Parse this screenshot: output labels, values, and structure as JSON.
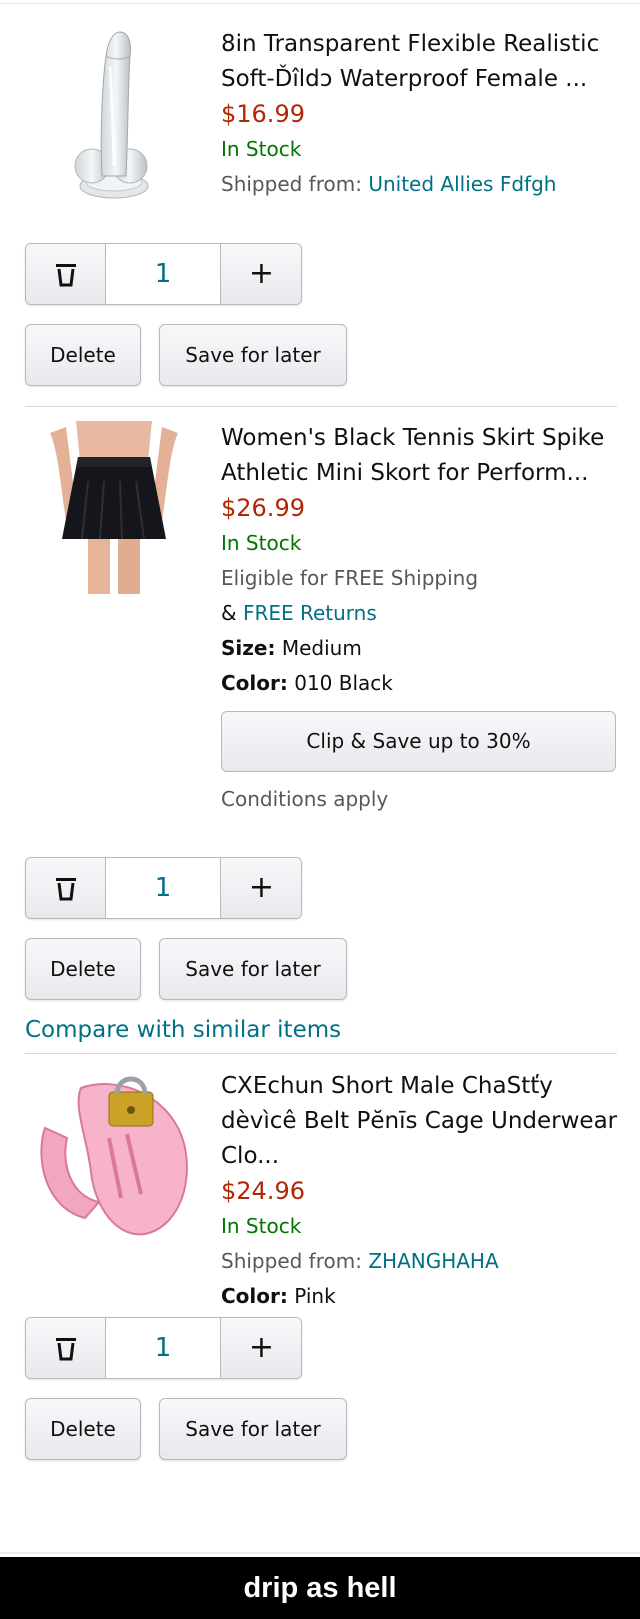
{
  "items": [
    {
      "title": "8in Transparent Flexible Realistic Soft-Ďîldɔ Waterproof Female ...",
      "price": "$16.99",
      "stock": "In Stock",
      "shipped_label": "Shipped from: ",
      "seller": "United Allies Fdfgh",
      "quantity": "1"
    },
    {
      "title": "Women's Black Tennis Skirt Spike Athletic Mini Skort for Perform...",
      "price": "$26.99",
      "stock": "In Stock",
      "shipping_line": "Eligible for FREE Shipping",
      "returns_prefix": "& ",
      "returns_link": "FREE Returns",
      "size_label": "Size:",
      "size_value": " Medium",
      "color_label": "Color:",
      "color_value": " 010 Black",
      "clip_button": "Clip & Save up to 30%",
      "conditions": "Conditions apply",
      "quantity": "1"
    },
    {
      "title": "CXEchun Short Male ChaStťy dèvìcê Belt Pĕnīs Cage Underwear Clo...",
      "price": "$24.96",
      "stock": "In Stock",
      "shipped_label": "Shipped from: ",
      "seller": "ZHANGHAHA",
      "color_label": "Color:",
      "color_value": " Pink",
      "quantity": "1"
    }
  ],
  "buttons": {
    "plus": "+",
    "delete": "Delete",
    "save_for_later": "Save for later"
  },
  "compare_link": "Compare with similar items",
  "caption": "drip as hell",
  "colors": {
    "price": "#b12704",
    "in_stock": "#007600",
    "link": "#007185",
    "secondary_text": "#565959",
    "caption_bg": "#000000"
  }
}
